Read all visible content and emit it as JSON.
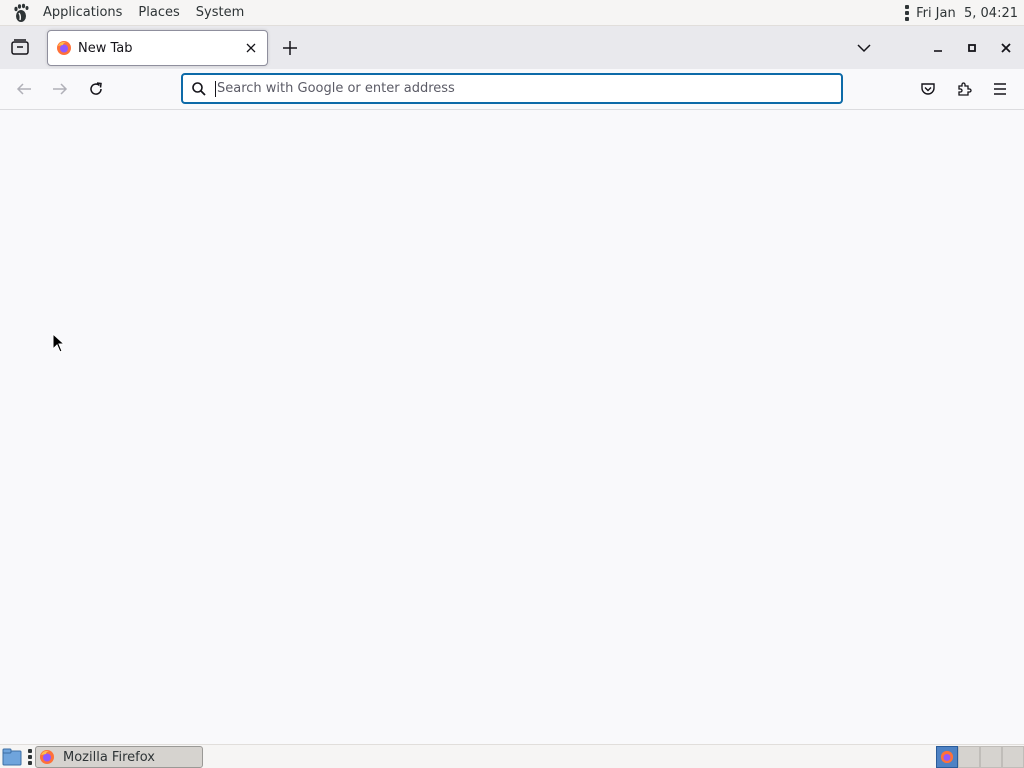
{
  "top_panel": {
    "menus": [
      "Applications",
      "Places",
      "System"
    ],
    "clock": "Fri Jan  5, 04:21"
  },
  "browser": {
    "tab": {
      "title": "New Tab"
    },
    "urlbar": {
      "placeholder": "Search with Google or enter address",
      "value": ""
    }
  },
  "taskbar": {
    "window_label": "Mozilla Firefox",
    "workspaces": 4,
    "active_workspace": 1
  },
  "colors": {
    "focus_ring": "#0d6aa8",
    "tabstrip_bg": "#e9e9ed",
    "content_bg": "#f9f9fb",
    "panel_bg": "#f6f5f4"
  },
  "icons": {
    "panel_logo": "gnome-foot-icon",
    "tab_favicon": "firefox-icon",
    "nav": [
      "back-arrow-icon",
      "forward-arrow-icon",
      "reload-icon"
    ],
    "toolbar_right": [
      "pocket-icon",
      "extensions-icon",
      "hamburger-menu-icon"
    ]
  }
}
